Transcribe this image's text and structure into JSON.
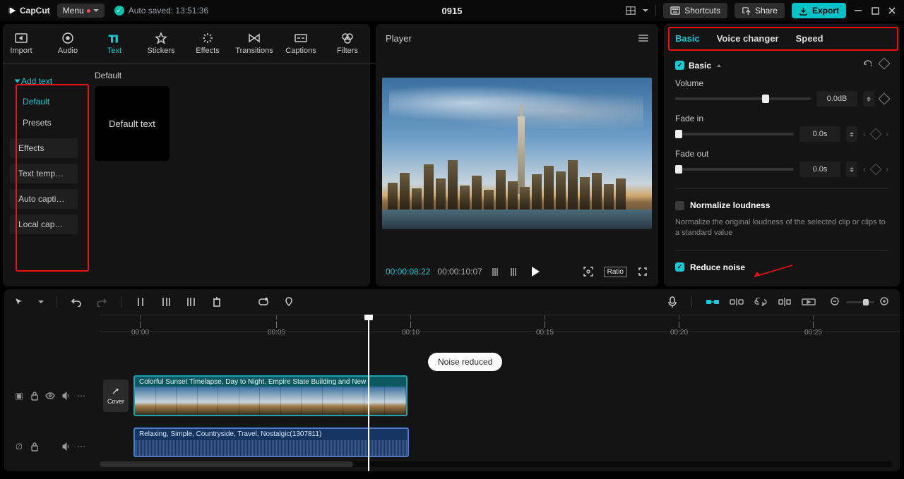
{
  "app": {
    "brand": "CapCut",
    "menu": "Menu",
    "autosave": "Auto saved: 13:51:36",
    "project": "0915"
  },
  "topright": {
    "shortcuts": "Shortcuts",
    "share": "Share",
    "export": "Export"
  },
  "ribbon": [
    "Import",
    "Audio",
    "Text",
    "Stickers",
    "Effects",
    "Transitions",
    "Captions",
    "Filters"
  ],
  "sidebar": {
    "group": "Add text",
    "items": [
      "Default",
      "Presets"
    ],
    "cats": [
      "Effects",
      "Text template",
      "Auto captio...",
      "Local capti..."
    ]
  },
  "content": {
    "heading": "Default",
    "card": "Default text"
  },
  "player": {
    "title": "Player",
    "cur": "00:00:08:22",
    "dur": "00:00:10:07",
    "ratio": "Ratio"
  },
  "tabs": [
    "Basic",
    "Voice changer",
    "Speed"
  ],
  "inspector": {
    "section": "Basic",
    "volume_label": "Volume",
    "volume_val": "0.0dB",
    "fadein_label": "Fade in",
    "fadein_val": "0.0s",
    "fadeout_label": "Fade out",
    "fadeout_val": "0.0s",
    "norm_title": "Normalize loudness",
    "norm_desc": "Normalize the original loudness of the selected clip or clips to a standard value",
    "reduce": "Reduce noise"
  },
  "timeline": {
    "ticks": [
      "00:00",
      "00:05",
      "00:10",
      "00:15",
      "00:20",
      "00:25"
    ],
    "cover": "Cover",
    "video_title": "Colorful Sunset Timelapse, Day to Night, Empire State Building and New",
    "audio_title": "Relaxing, Simple, Countryside, Travel, Nostalgic(1307811)",
    "toast": "Noise reduced"
  }
}
